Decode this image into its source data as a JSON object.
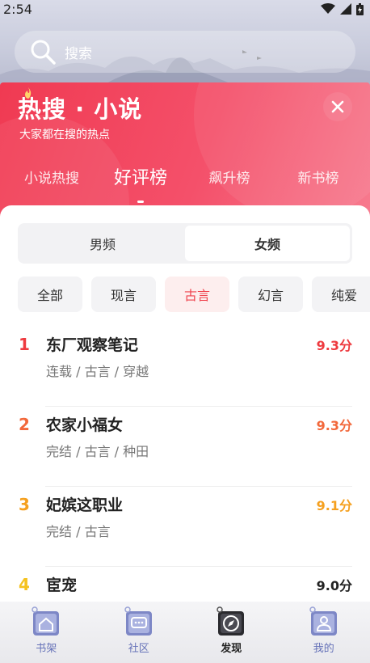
{
  "status": {
    "time": "2:54"
  },
  "search": {
    "placeholder": "搜索"
  },
  "header": {
    "title": "热搜 · 小说",
    "subtitle": "大家都在搜的热点",
    "tabs": [
      {
        "label": "小说热搜"
      },
      {
        "label": "好评榜"
      },
      {
        "label": "飙升榜"
      },
      {
        "label": "新书榜"
      }
    ],
    "active_tab": 1
  },
  "gender": {
    "options": [
      "男频",
      "女频"
    ],
    "active": 1
  },
  "categories": [
    "全部",
    "现言",
    "古言",
    "幻言",
    "纯爱"
  ],
  "active_category": 2,
  "books": [
    {
      "rank": "1",
      "title": "东厂观察笔记",
      "meta": "连载 / 古言 / 穿越",
      "score": "9.3分",
      "color": "#ee3a3f"
    },
    {
      "rank": "2",
      "title": "农家小福女",
      "meta": "完结 / 古言 / 种田",
      "score": "9.3分",
      "color": "#f2683b"
    },
    {
      "rank": "3",
      "title": "妃嫔这职业",
      "meta": "完结 / 古言",
      "score": "9.1分",
      "color": "#f5a01f"
    },
    {
      "rank": "4",
      "title": "宦宠",
      "meta": "",
      "score": "9.0分",
      "color": "#f5c21f"
    }
  ],
  "nav": [
    {
      "label": "书架",
      "icon": "bookshelf-icon",
      "color": "#6672b8"
    },
    {
      "label": "社区",
      "icon": "community-icon",
      "color": "#6672b8"
    },
    {
      "label": "发现",
      "icon": "discover-icon",
      "color": "#222222"
    },
    {
      "label": "我的",
      "icon": "profile-icon",
      "color": "#6672b8"
    }
  ],
  "colors": {
    "accent": "#f0434e",
    "header_gradient_start": "#f03a52",
    "header_gradient_end": "#f77a8e"
  }
}
